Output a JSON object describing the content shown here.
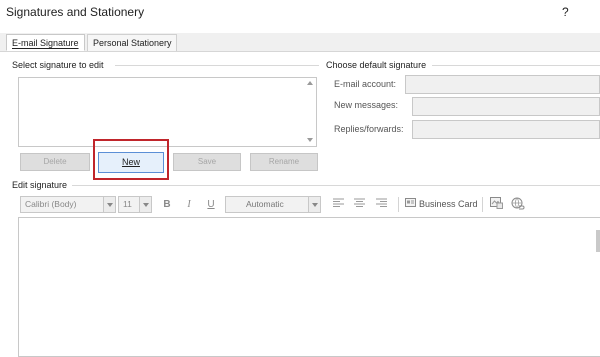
{
  "window": {
    "title": "Signatures and Stationery",
    "help": "?"
  },
  "tabs": [
    {
      "label": "E-mail Signature",
      "active": true
    },
    {
      "label": "Personal Stationery",
      "active": false
    }
  ],
  "select_signature": {
    "label": "Select signature to edit",
    "buttons": {
      "delete": "Delete",
      "new": "New",
      "save": "Save",
      "rename": "Rename"
    }
  },
  "default_signature": {
    "label": "Choose default signature",
    "email_account": "E-mail account:",
    "new_messages": "New messages:",
    "replies_forwards": "Replies/forwards:"
  },
  "edit_signature": {
    "label": "Edit signature",
    "font": "Calibri (Body)",
    "size": "11",
    "color": "Automatic",
    "business_card": "Business Card"
  },
  "colors": {
    "highlight": "#c0252b",
    "new_button_border": "#5b8fd6"
  },
  "icons": [
    "bold-icon",
    "italic-icon",
    "underline-icon",
    "align-left-icon",
    "align-center-icon",
    "align-right-icon",
    "business-card-icon",
    "insert-picture-icon",
    "insert-hyperlink-icon"
  ]
}
